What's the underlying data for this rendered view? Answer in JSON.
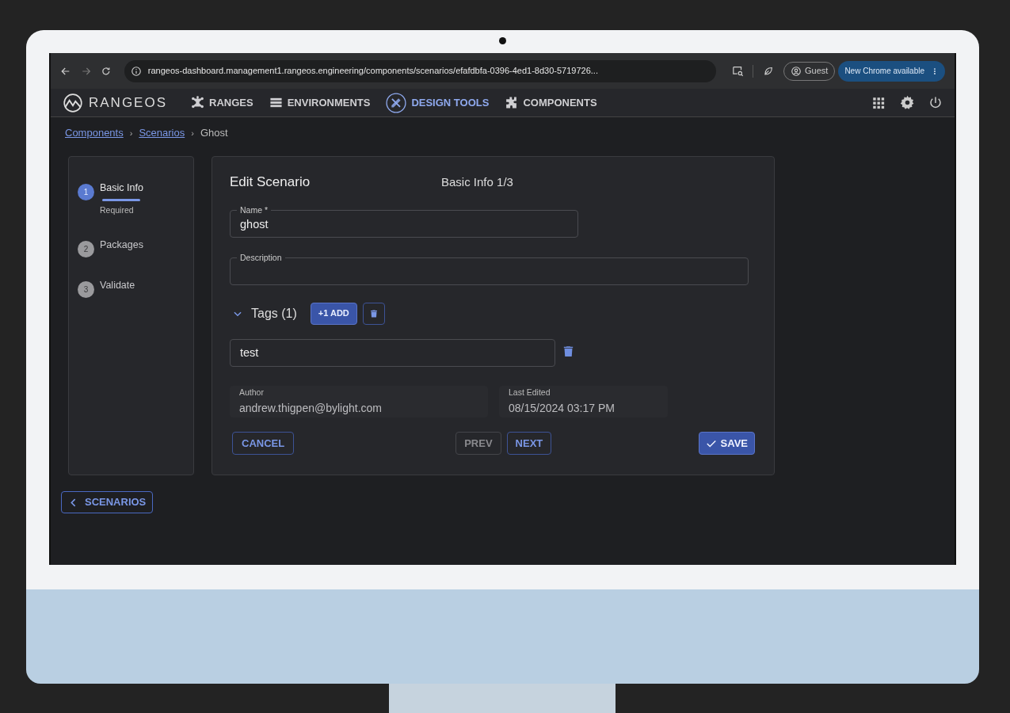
{
  "browser": {
    "url": "rangeos-dashboard.management1.rangeos.engineering/components/scenarios/efafdbfa-0396-4ed1-8d30-5719726...",
    "profile": "Guest",
    "update_button": "New Chrome available"
  },
  "app": {
    "logo": "RANGEOS",
    "nav": [
      {
        "label": "RANGES",
        "kind": "ranges",
        "selected": false
      },
      {
        "label": "ENVIRONMENTS",
        "kind": "environments",
        "selected": false
      },
      {
        "label": "DESIGN TOOLS",
        "kind": "design",
        "selected": true
      },
      {
        "label": "COMPONENTS",
        "kind": "components",
        "selected": false
      }
    ]
  },
  "breadcrumb_separator": "›",
  "breadcrumb": [
    {
      "label": "Components",
      "link": true
    },
    {
      "label": "Scenarios",
      "link": true
    },
    {
      "label": "Ghost",
      "link": false
    }
  ],
  "stepper": [
    {
      "number": "1",
      "label": "Basic Info",
      "sublabel": "Required",
      "selected": true
    },
    {
      "number": "2",
      "label": "Packages",
      "selected": false
    },
    {
      "number": "3",
      "label": "Validate",
      "selected": false
    }
  ],
  "form": {
    "title": "Edit Scenario",
    "step_label": "Basic Info 1/3",
    "name": {
      "label": "Name *",
      "value": "ghost"
    },
    "description": {
      "label": "Description"
    },
    "tags": {
      "label": "Tags (1)",
      "expanded": true,
      "add_button": "+1 ADD",
      "items": [
        {
          "value": "test"
        }
      ]
    },
    "author": {
      "label": "Author",
      "value": "andrew.thigpen@bylight.com"
    },
    "last_edited": {
      "label": "Last Edited",
      "value": "08/15/2024 03:17 PM"
    },
    "buttons": {
      "cancel": "CANCEL",
      "prev": {
        "label": "PREV",
        "disabled": true
      },
      "next": {
        "label": "NEXT",
        "disabled": false
      },
      "save": "SAVE"
    }
  },
  "back_button": "SCENARIOS"
}
